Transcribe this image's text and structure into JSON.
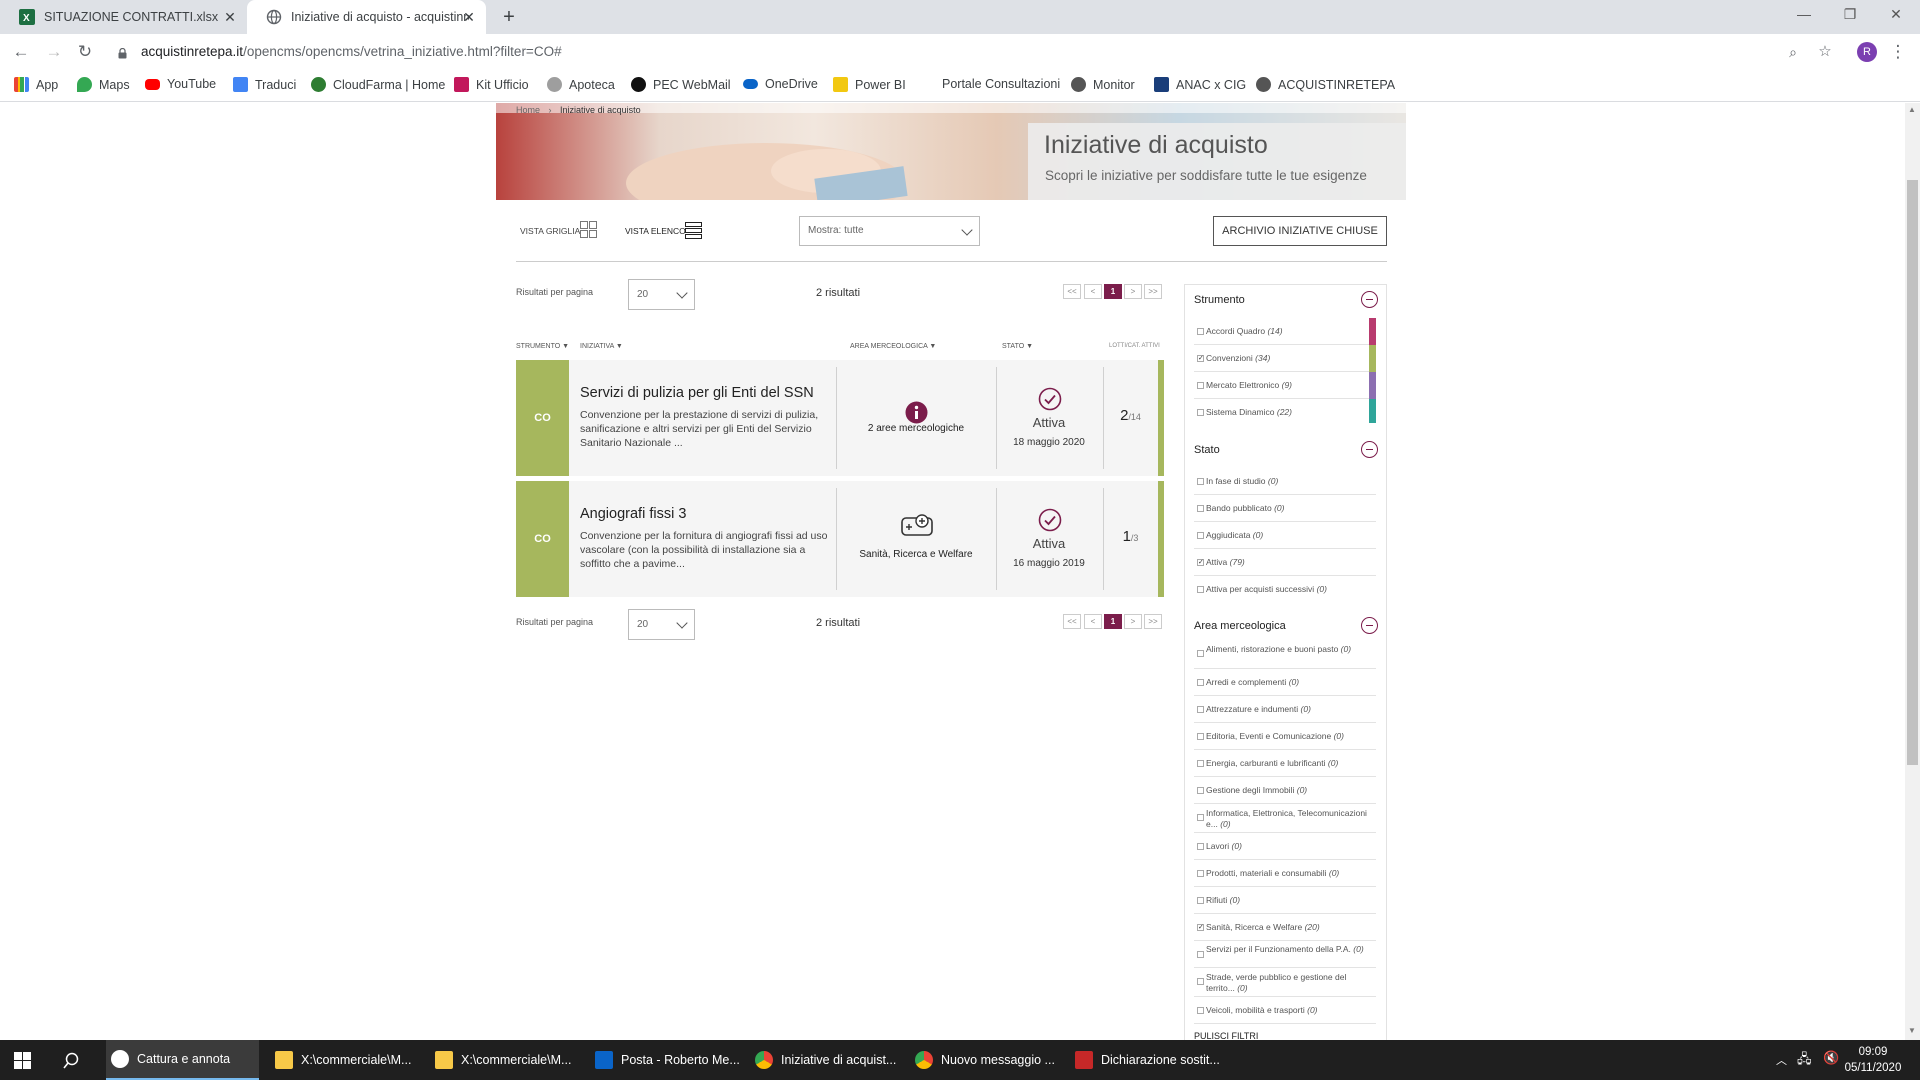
{
  "browser": {
    "tabs": [
      {
        "title": "SITUAZIONE CONTRATTI.xlsx",
        "active": false
      },
      {
        "title": "Iniziative di acquisto - acquistinre",
        "active": true
      }
    ],
    "url_host": "acquistinretepa.it",
    "url_path": "/opencms/opencms/vetrina_iniziative.html?filter=CO#",
    "profile_initial": "R",
    "bookmarks": [
      "App",
      "Maps",
      "YouTube",
      "Traduci",
      "CloudFarma | Home",
      "Kit Ufficio",
      "Apoteca",
      "PEC WebMail",
      "OneDrive",
      "Power BI",
      "Portale Consultazioni",
      "Monitor",
      "ANAC x CIG",
      "ACQUISTINRETEPA"
    ]
  },
  "breadcrumb": {
    "home": "Home",
    "sep": "›",
    "current": "Iniziative di acquisto"
  },
  "hero": {
    "title": "Iniziative di acquisto",
    "subtitle": "Scopri le iniziative per soddisfare tutte le tue esigenze"
  },
  "controls": {
    "grid_label": "VISTA GRIGLIA",
    "list_label": "VISTA ELENCO",
    "show_select": "Mostra: tutte",
    "archive_button": "ARCHIVIO INIZIATIVE CHIUSE"
  },
  "results": {
    "per_page_label": "Risultati per pagina",
    "per_page_value": "20",
    "count": "2 risultati",
    "pager": [
      "<<",
      "<",
      "1",
      ">",
      ">>"
    ]
  },
  "table_headers": [
    "STRUMENTO",
    "INIZIATIVA",
    "AREA MERCEOLOGICA",
    "STATO",
    "LOTTI/CAT. ATTIVI"
  ],
  "initiatives": [
    {
      "tool": "CO",
      "title": "Servizi di pulizia per gli Enti del SSN",
      "description": "Convenzione per la prestazione di servizi di pulizia, sanificazione e altri servizi per gli Enti del Servizio Sanitario Nazionale ...",
      "area": "2 aree merceologiche",
      "status": "Attiva",
      "date": "18 maggio 2020",
      "lots_active": "2",
      "lots_total": "/14"
    },
    {
      "tool": "CO",
      "title": "Angiografi fissi 3",
      "description": "Convenzione per la fornitura di angiografi fissi ad uso vascolare (con la possibilità di installazione sia a soffitto che a pavime...",
      "area": "Sanità, Ricerca e Welfare",
      "status": "Attiva",
      "date": "16 maggio 2019",
      "lots_active": "1",
      "lots_total": "/3"
    }
  ],
  "filters": {
    "strumento": {
      "title": "Strumento",
      "items": [
        {
          "label": "Accordi Quadro",
          "count": "(14)",
          "checked": false,
          "color": "#b83b6e"
        },
        {
          "label": "Convenzioni",
          "count": "(34)",
          "checked": true,
          "color": "#a6b75d"
        },
        {
          "label": "Mercato Elettronico",
          "count": "(9)",
          "checked": false,
          "color": "#8c6fb1"
        },
        {
          "label": "Sistema Dinamico",
          "count": "(22)",
          "checked": false,
          "color": "#2fa59a"
        }
      ]
    },
    "stato": {
      "title": "Stato",
      "items": [
        {
          "label": "In fase di studio",
          "count": "(0)",
          "checked": false
        },
        {
          "label": "Bando pubblicato",
          "count": "(0)",
          "checked": false
        },
        {
          "label": "Aggiudicata",
          "count": "(0)",
          "checked": false
        },
        {
          "label": "Attiva",
          "count": "(79)",
          "checked": true
        },
        {
          "label": "Attiva per acquisti successivi",
          "count": "(0)",
          "checked": false
        }
      ]
    },
    "area": {
      "title": "Area merceologica",
      "items": [
        {
          "label": "Alimenti, ristorazione e buoni pasto",
          "count": "(0)",
          "checked": false
        },
        {
          "label": "Arredi e complementi",
          "count": "(0)",
          "checked": false
        },
        {
          "label": "Attrezzature e indumenti",
          "count": "(0)",
          "checked": false
        },
        {
          "label": "Editoria, Eventi e Comunicazione",
          "count": "(0)",
          "checked": false
        },
        {
          "label": "Energia, carburanti e lubrificanti",
          "count": "(0)",
          "checked": false
        },
        {
          "label": "Gestione degli Immobili",
          "count": "(0)",
          "checked": false
        },
        {
          "label": "Informatica, Elettronica, Telecomunicazioni e...",
          "count": "(0)",
          "checked": false
        },
        {
          "label": "Lavori",
          "count": "(0)",
          "checked": false
        },
        {
          "label": "Prodotti, materiali e consumabili",
          "count": "(0)",
          "checked": false
        },
        {
          "label": "Rifiuti",
          "count": "(0)",
          "checked": false
        },
        {
          "label": "Sanità, Ricerca e Welfare",
          "count": "(20)",
          "checked": true
        },
        {
          "label": "Servizi per il Funzionamento della P.A.",
          "count": "(0)",
          "checked": false
        },
        {
          "label": "Strade, verde pubblico e gestione del territo...",
          "count": "(0)",
          "checked": false
        },
        {
          "label": "Veicoli, mobilità e trasporti",
          "count": "(0)",
          "checked": false
        }
      ]
    },
    "clear": "PULISCI FILTRI"
  },
  "taskbar": {
    "items": [
      {
        "label": "Cattura e annota",
        "icon": "snip-icon",
        "active": true
      },
      {
        "label": "X:\\commerciale\\M...",
        "icon": "folder-icon"
      },
      {
        "label": "X:\\commerciale\\M...",
        "icon": "folder-icon"
      },
      {
        "label": "Posta - Roberto Me...",
        "icon": "outlook-icon"
      },
      {
        "label": "Iniziative di acquist...",
        "icon": "chrome-icon"
      },
      {
        "label": "Nuovo messaggio ...",
        "icon": "chrome-icon"
      },
      {
        "label": "Dichiarazione sostit...",
        "icon": "pdf-icon"
      }
    ],
    "time": "09:09",
    "date": "05/11/2020"
  }
}
